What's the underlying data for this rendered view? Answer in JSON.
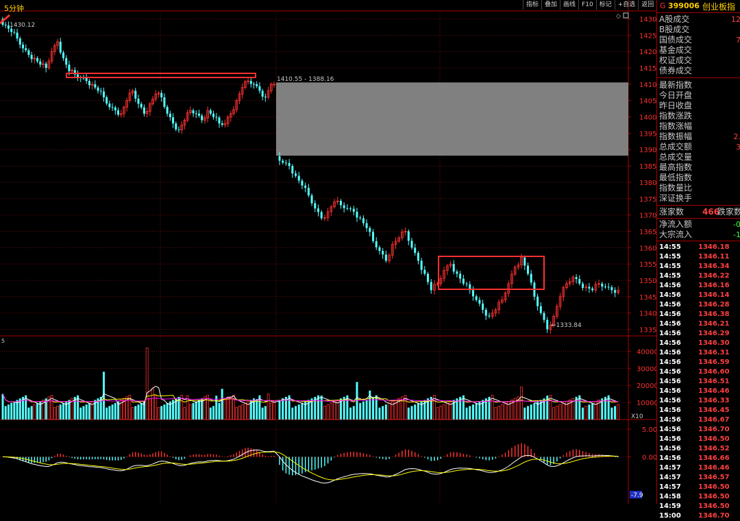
{
  "period_label": "5分钟",
  "toolbar": [
    "指标",
    "叠加",
    "画线",
    "F10",
    "标记",
    "+自选",
    "返回"
  ],
  "header": {
    "g": "G",
    "code": "399006",
    "name": "创业板指"
  },
  "side_rows": [
    "A股成交",
    "B股成交",
    "国债成交",
    "基金成交",
    "权证成交",
    "债券成交"
  ],
  "side_rows_vals": [
    "12",
    "",
    "7",
    "",
    "",
    ""
  ],
  "index_rows": [
    "最新指数",
    "今日开盘",
    "昨日收盘",
    "指数涨跌",
    "指数涨幅",
    "指数振幅",
    "总成交额",
    "总成交量",
    "最高指数",
    "最低指数",
    "指数量比",
    "深证换手"
  ],
  "index_rows_vals": [
    "",
    "",
    "",
    "",
    "",
    "2.",
    "3",
    "",
    "",
    "",
    "",
    ""
  ],
  "advance": {
    "label1": "涨家数",
    "value": "466",
    "label2": "跌家数"
  },
  "flow": [
    {
      "label": "净流入额",
      "value": "-0"
    },
    {
      "label": "大宗流入",
      "value": "-1"
    }
  ],
  "ticks": [
    {
      "time": "14:55",
      "price": "1346.18"
    },
    {
      "time": "14:55",
      "price": "1346.11"
    },
    {
      "time": "14:55",
      "price": "1346.34"
    },
    {
      "time": "14:55",
      "price": "1346.22"
    },
    {
      "time": "14:56",
      "price": "1346.16"
    },
    {
      "time": "14:56",
      "price": "1346.14"
    },
    {
      "time": "14:56",
      "price": "1346.28"
    },
    {
      "time": "14:56",
      "price": "1346.38"
    },
    {
      "time": "14:56",
      "price": "1346.21"
    },
    {
      "time": "14:56",
      "price": "1346.29"
    },
    {
      "time": "14:56",
      "price": "1346.30"
    },
    {
      "time": "14:56",
      "price": "1346.31"
    },
    {
      "time": "14:56",
      "price": "1346.59"
    },
    {
      "time": "14:56",
      "price": "1346.60"
    },
    {
      "time": "14:56",
      "price": "1346.51"
    },
    {
      "time": "14:56",
      "price": "1346.46"
    },
    {
      "time": "14:56",
      "price": "1346.33"
    },
    {
      "time": "14:56",
      "price": "1346.45"
    },
    {
      "time": "14:56",
      "price": "1346.67"
    },
    {
      "time": "14:56",
      "price": "1346.70"
    },
    {
      "time": "14:56",
      "price": "1346.50"
    },
    {
      "time": "14:56",
      "price": "1346.52"
    },
    {
      "time": "14:56",
      "price": "1346.66"
    },
    {
      "time": "14:57",
      "price": "1346.46"
    },
    {
      "time": "14:57",
      "price": "1346.57"
    },
    {
      "time": "14:57",
      "price": "1346.50"
    },
    {
      "time": "14:58",
      "price": "1346.50"
    },
    {
      "time": "14:59",
      "price": "1346.50"
    },
    {
      "time": "15:00",
      "price": "1346.70"
    }
  ],
  "chart_data": {
    "type": "candlestick",
    "price_axis": {
      "min": 1333,
      "max": 1432,
      "ticks": [
        "1430",
        "1425",
        "1420",
        "1415",
        "1410",
        "1405",
        "1400",
        "1395",
        "1390",
        "1385",
        "1380",
        "1375",
        "1370",
        "1365",
        "1360",
        "1355",
        "1350",
        "1345",
        "1340",
        "1335"
      ]
    },
    "annotations": {
      "high": "1430.12",
      "low": "←1333.84",
      "gap": "1410.55 - 1388.16"
    },
    "gap": {
      "top": 1410.55,
      "bottom": 1388.16
    },
    "price_path": [
      1430,
      1428,
      1426,
      1424,
      1421,
      1419,
      1418,
      1416,
      1415,
      1420,
      1423,
      1418,
      1414,
      1413,
      1412,
      1411,
      1410,
      1408,
      1406,
      1403,
      1402,
      1401,
      1405,
      1408,
      1404,
      1401,
      1404,
      1407,
      1406,
      1401,
      1398,
      1396,
      1399,
      1402,
      1401,
      1399,
      1402,
      1400,
      1398,
      1398,
      1401,
      1405,
      1409,
      1411,
      1410,
      1408,
      1406,
      1410,
      1388,
      1386,
      1385,
      1382,
      1379,
      1376,
      1372,
      1369,
      1371,
      1374,
      1373,
      1372,
      1371,
      1369,
      1366,
      1362,
      1359,
      1356,
      1361,
      1363,
      1365,
      1360,
      1356,
      1352,
      1347,
      1349,
      1353,
      1355,
      1352,
      1349,
      1347,
      1344,
      1341,
      1339,
      1341,
      1344,
      1349,
      1354,
      1357,
      1352,
      1345,
      1340,
      1335,
      1339,
      1345,
      1349,
      1351,
      1349,
      1348,
      1347,
      1349,
      1348,
      1347,
      1347
    ],
    "volume_axis": {
      "max": 45000,
      "ticks": [
        "40000",
        "30000",
        "20000",
        "10000"
      ],
      "unit": "X10"
    },
    "macd_axis": {
      "min": -8.5,
      "max": 6.5,
      "ticks": [
        "5.00",
        "0.00"
      ],
      "current": "-7.9"
    },
    "colors": {
      "up": "#ff3232",
      "down": "#54ffff",
      "ma5": "#ffffff",
      "ma10": "#ffff00",
      "ma20": "#ff00ff",
      "gap": "#808080",
      "box": "#ff3030"
    }
  }
}
